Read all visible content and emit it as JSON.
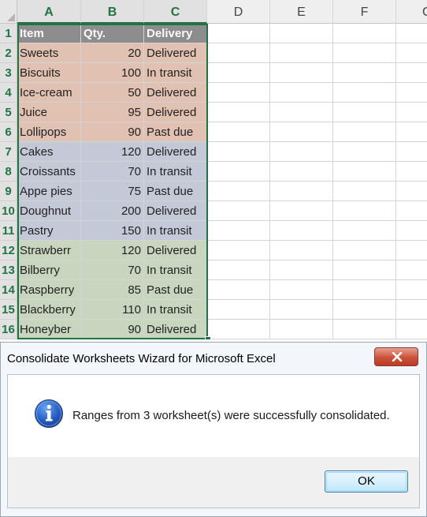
{
  "sheet": {
    "columns": [
      "A",
      "B",
      "C",
      "D",
      "E",
      "F",
      "G"
    ],
    "rows": [
      "1",
      "2",
      "3",
      "4",
      "5",
      "6",
      "7",
      "8",
      "9",
      "10",
      "11",
      "12",
      "13",
      "14",
      "15",
      "16"
    ],
    "header": {
      "item": "Item",
      "qty": "Qty.",
      "delivery": "Delivery"
    },
    "data": [
      {
        "item": "Sweets",
        "qty": "20",
        "delivery": "Delivered",
        "group": 1
      },
      {
        "item": "Biscuits",
        "qty": "100",
        "delivery": "In transit",
        "group": 1
      },
      {
        "item": "Ice-cream",
        "qty": "50",
        "delivery": "Delivered",
        "group": 1
      },
      {
        "item": "Juice",
        "qty": "95",
        "delivery": "Delivered",
        "group": 1
      },
      {
        "item": "Lollipops",
        "qty": "90",
        "delivery": "Past due",
        "group": 1
      },
      {
        "item": "Cakes",
        "qty": "120",
        "delivery": "Delivered",
        "group": 2
      },
      {
        "item": "Croissants",
        "qty": "70",
        "delivery": "In transit",
        "group": 2
      },
      {
        "item": "Appe pies",
        "qty": "75",
        "delivery": "Past due",
        "group": 2
      },
      {
        "item": "Doughnut",
        "qty": "200",
        "delivery": "Delivered",
        "group": 2
      },
      {
        "item": "Pastry",
        "qty": "150",
        "delivery": "In transit",
        "group": 2
      },
      {
        "item": "Strawberr",
        "qty": "120",
        "delivery": "Delivered",
        "group": 3
      },
      {
        "item": "Bilberry",
        "qty": "70",
        "delivery": "In transit",
        "group": 3
      },
      {
        "item": "Raspberry",
        "qty": "85",
        "delivery": "Past due",
        "group": 3
      },
      {
        "item": "Blackberry",
        "qty": "110",
        "delivery": "In transit",
        "group": 3
      },
      {
        "item": "Honeyber",
        "qty": "90",
        "delivery": "Delivered",
        "group": 3
      }
    ],
    "colors": {
      "header_fill": "#8d8d8d",
      "group_1_fill": "#e0c1b2",
      "group_2_fill": "#c3c9d7",
      "group_3_fill": "#c8d6bf",
      "selection_accent": "#217346"
    }
  },
  "dialog": {
    "title": "Consolidate Worksheets Wizard for Microsoft Excel",
    "close_icon": "close-x-icon",
    "icon": "info-icon",
    "message": "Ranges from 3 worksheet(s) were successfully consolidated.",
    "ok_label": "OK"
  }
}
